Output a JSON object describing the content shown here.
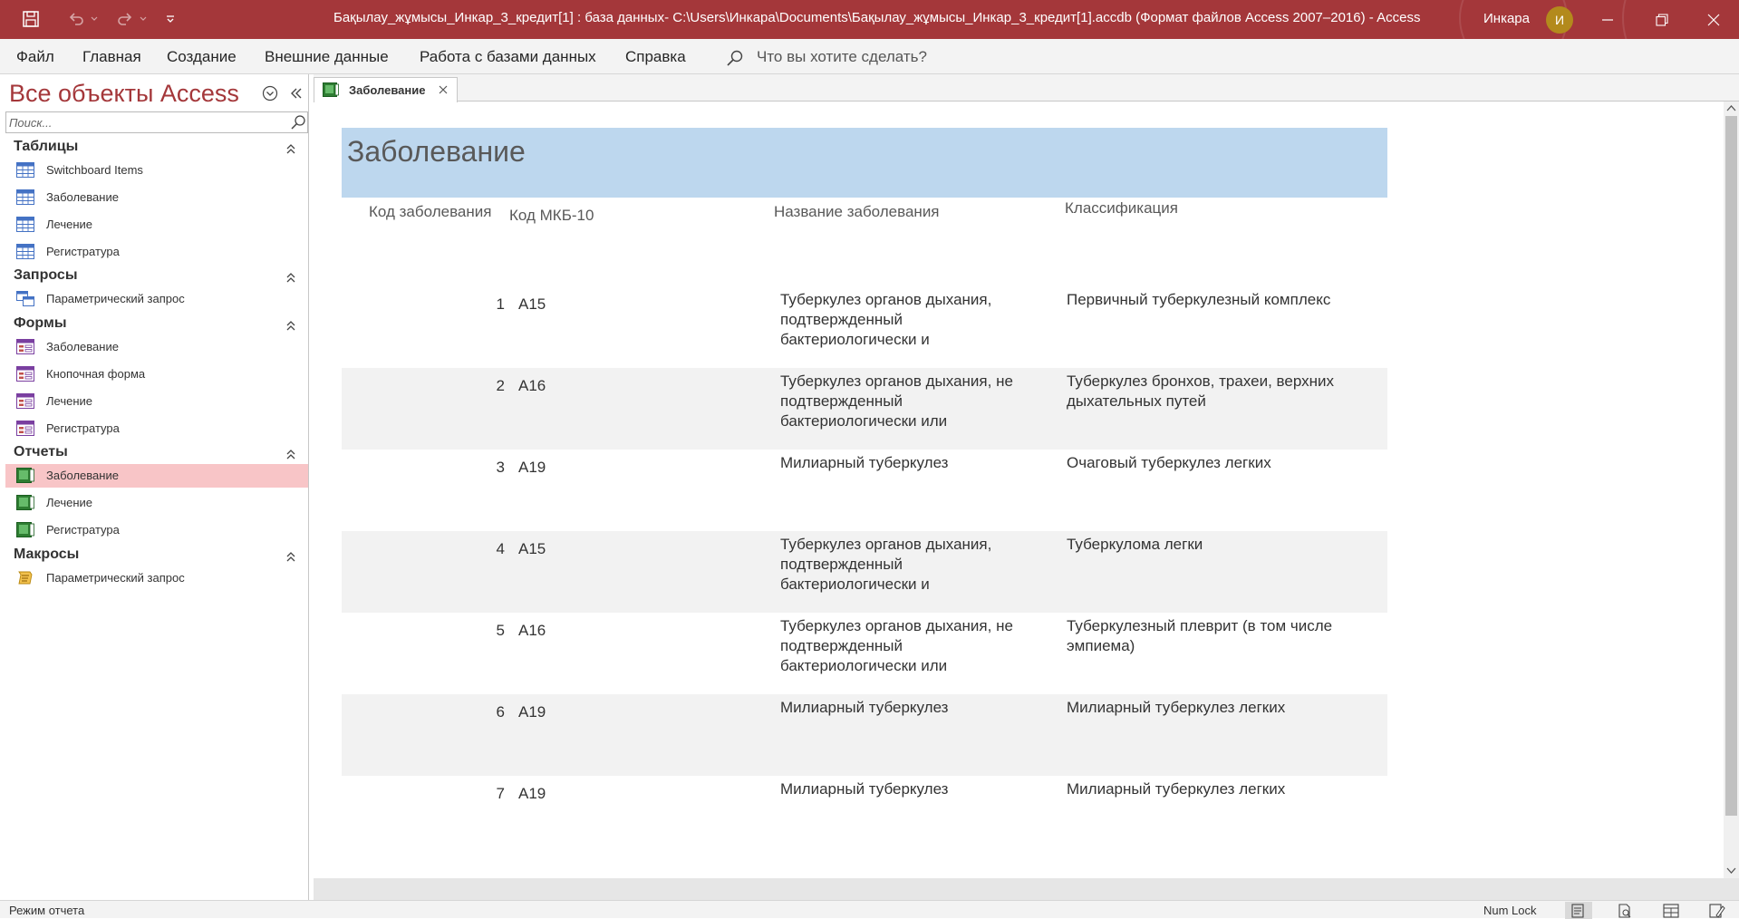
{
  "window": {
    "title": "Бақылау_жұмысы_Инкар_3_кредит[1] : база данных- C:\\Users\\Инкара\\Documents\\Бақылау_жұмысы_Инкар_3_кредит[1].accdb (Формат файлов Access 2007–2016)  -  Access",
    "user_name": "Инкара",
    "user_initial": "И"
  },
  "menu": {
    "items": [
      "Файл",
      "Главная",
      "Создание",
      "Внешние данные",
      "Работа с базами данных",
      "Справка"
    ],
    "tell_me": "Что вы хотите сделать?"
  },
  "nav": {
    "title": "Все объекты Access",
    "search_placeholder": "Поиск...",
    "groups": [
      {
        "label": "Таблицы",
        "items": [
          "Switchboard Items",
          "Заболевание",
          "Лечение",
          "Регистратура"
        ]
      },
      {
        "label": "Запросы",
        "items": [
          "Параметрический запрос"
        ]
      },
      {
        "label": "Формы",
        "items": [
          "Заболевание",
          "Кнопочная форма",
          "Лечение",
          "Регистратура"
        ]
      },
      {
        "label": "Отчеты",
        "items": [
          "Заболевание",
          "Лечение",
          "Регистратура"
        ]
      },
      {
        "label": "Макросы",
        "items": [
          "Параметрический запрос"
        ]
      }
    ],
    "selected": "Отчеты/Заболевание"
  },
  "tab": {
    "label": "Заболевание"
  },
  "report": {
    "title": "Заболевание",
    "columns": [
      "Код заболевания",
      "Код МКБ-10",
      "Название заболевания",
      "Классификация"
    ],
    "rows": [
      {
        "id": "1",
        "mkb": "A15",
        "name": "Туберкулез органов дыхания, подтвержденный бактериологически и",
        "cls": "Первичный туберкулезный комплекс"
      },
      {
        "id": "2",
        "mkb": "A16",
        "name": "Туберкулез органов дыхания, не подтвержденный бактериологически или",
        "cls": "Туберкулез бронхов, трахеи, верхних дыхательных путей"
      },
      {
        "id": "3",
        "mkb": "A19",
        "name": "Милиарный туберкулез",
        "cls": "Очаговый туберкулез легких"
      },
      {
        "id": "4",
        "mkb": "A15",
        "name": "Туберкулез органов дыхания, подтвержденный бактериологически и",
        "cls": "Туберкулома легки"
      },
      {
        "id": "5",
        "mkb": "A16",
        "name": "Туберкулез органов дыхания, не подтвержденный бактериологически или",
        "cls": "Туберкулезный плеврит (в том числе эмпиема)"
      },
      {
        "id": "6",
        "mkb": "A19",
        "name": "Милиарный туберкулез",
        "cls": "Милиарный туберкулез легких"
      },
      {
        "id": "7",
        "mkb": "A19",
        "name": "Милиарный туберкулез",
        "cls": "Милиарный туберкулез легких"
      }
    ]
  },
  "status": {
    "mode": "Режим отчета",
    "numlock": "Num Lock"
  },
  "colors": {
    "accent": "#a4373a",
    "report_header": "#bdd7ee",
    "selected_item": "#f8c5c7",
    "alt_row": "#f2f2f2"
  },
  "icons": [
    "save-icon",
    "undo-icon",
    "redo-icon",
    "customize-qat-icon",
    "minimize-icon",
    "restore-icon",
    "close-icon",
    "search-icon",
    "table-icon",
    "query-icon",
    "form-icon",
    "report-icon",
    "macro-icon"
  ]
}
